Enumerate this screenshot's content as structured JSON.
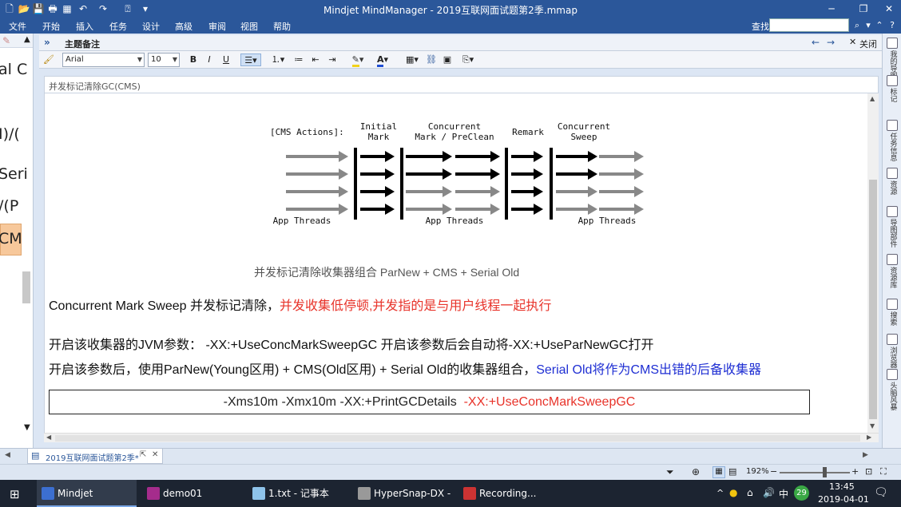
{
  "window": {
    "title": "Mindjet MindManager - 2019互联网面试题第2季.mmap"
  },
  "menubar": {
    "items": [
      "文件",
      "开始",
      "插入",
      "任务",
      "设计",
      "高级",
      "审阅",
      "视图",
      "帮助"
    ],
    "find_label": "查找:"
  },
  "left_strip": {
    "fragments": [
      "al C",
      "I)/(",
      "Seri",
      "/(P",
      "CM"
    ]
  },
  "pane": {
    "title": "主题备注",
    "close_label": "关闭"
  },
  "toolbar": {
    "font_family": "Arial",
    "font_size": "10",
    "bold": "B",
    "italic": "I",
    "underline": "U"
  },
  "subject": {
    "text": "并发标记清除GC(CMS)"
  },
  "figure": {
    "heading": "[CMS Actions]:",
    "phases": [
      {
        "line1": "Initial",
        "line2": "Mark"
      },
      {
        "line1": "Concurrent",
        "line2": "Mark / PreClean"
      },
      {
        "line1": "Remark",
        "line2": ""
      },
      {
        "line1": "Concurrent",
        "line2": "Sweep"
      }
    ],
    "thread_labels": [
      "App Threads",
      "App Threads",
      "App Threads"
    ]
  },
  "content": {
    "caption": "并发标记清除收集器组合 ParNew + CMS + Serial Old",
    "line1_black": "Concurrent Mark Sweep 并发标记清除，",
    "line1_red": "并发收集低停顿,并发指的是与用户线程一起执行",
    "line2": "开启该收集器的JVM参数：  -XX:+UseConcMarkSweepGC    开启该参数后会自动将-XX:+UseParNewGC打开",
    "line3_black": "开启该参数后，使用ParNew(Young区用) + CMS(Old区用) + Serial Old的收集器组合，",
    "line3_blue": "Serial Old将作为CMS出错的后备收集器",
    "box_black": "-Xms10m -Xmx10m -XX:+PrintGCDetails",
    "box_red": "-XX:+UseConcMarkSweepGC"
  },
  "right_panel": {
    "tabs": [
      "我的导图",
      "标记",
      "任务信息",
      "资源",
      "导图部件",
      "资源库",
      "搜索",
      "浏览器",
      "头脑风暴"
    ]
  },
  "doc_tabs": {
    "active": "2019互联网面试题第2季*"
  },
  "status": {
    "zoom": "192%"
  },
  "taskbar": {
    "items": [
      "Mindjet MindMa...",
      "demo01 [D:\\devS...",
      "1.txt - 记事本",
      "HyperSnap-DX - [...",
      "Recording..."
    ],
    "tray_ime": "中",
    "tray_badge": "29",
    "time": "13:45",
    "date": "2019-04-01"
  },
  "colors": {
    "title_bar": "#2b579a",
    "red_text": "#e8332a",
    "blue_text": "#1f2fd3",
    "taskbar": "#1c2431"
  }
}
